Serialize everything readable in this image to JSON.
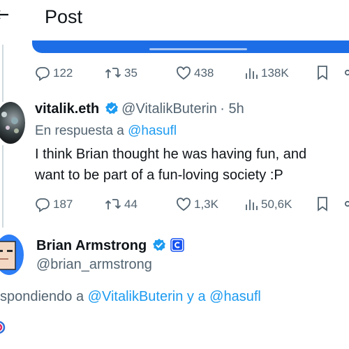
{
  "header": {
    "title": "Post"
  },
  "colors": {
    "accent": "#1d9bf0",
    "verified": "#1d9bf0",
    "muted": "#536471",
    "media_blue": "#1d6ee6"
  },
  "post1": {
    "actions": {
      "replies": "122",
      "reposts": "35",
      "likes": "438",
      "views": "138K"
    }
  },
  "post2": {
    "name": "vitalik.eth",
    "handle": "@VitalikButerin",
    "time": "· 5h",
    "reply_prefix": "En respuesta a",
    "reply_mention": "@hasufl",
    "text_line1": "I think Brian thought he was having fun, and",
    "text_line2": "want to be part of a fun-loving society :P",
    "actions": {
      "replies": "187",
      "reposts": "44",
      "likes": "1,3K",
      "views": "50,6K"
    }
  },
  "main_post": {
    "name": "Brian Armstrong",
    "handle": "@brian_armstrong",
    "reply_prefix": "spondiendo a",
    "reply_mention1": "@VitalikButerin",
    "reply_join": "y a",
    "reply_mention2": "@hasufl"
  },
  "icons": [
    "back-arrow-icon",
    "reply-icon",
    "repost-icon",
    "like-icon",
    "views-icon",
    "bookmark-icon",
    "share-icon",
    "verified-badge-icon",
    "coinbase-affiliate-icon"
  ]
}
